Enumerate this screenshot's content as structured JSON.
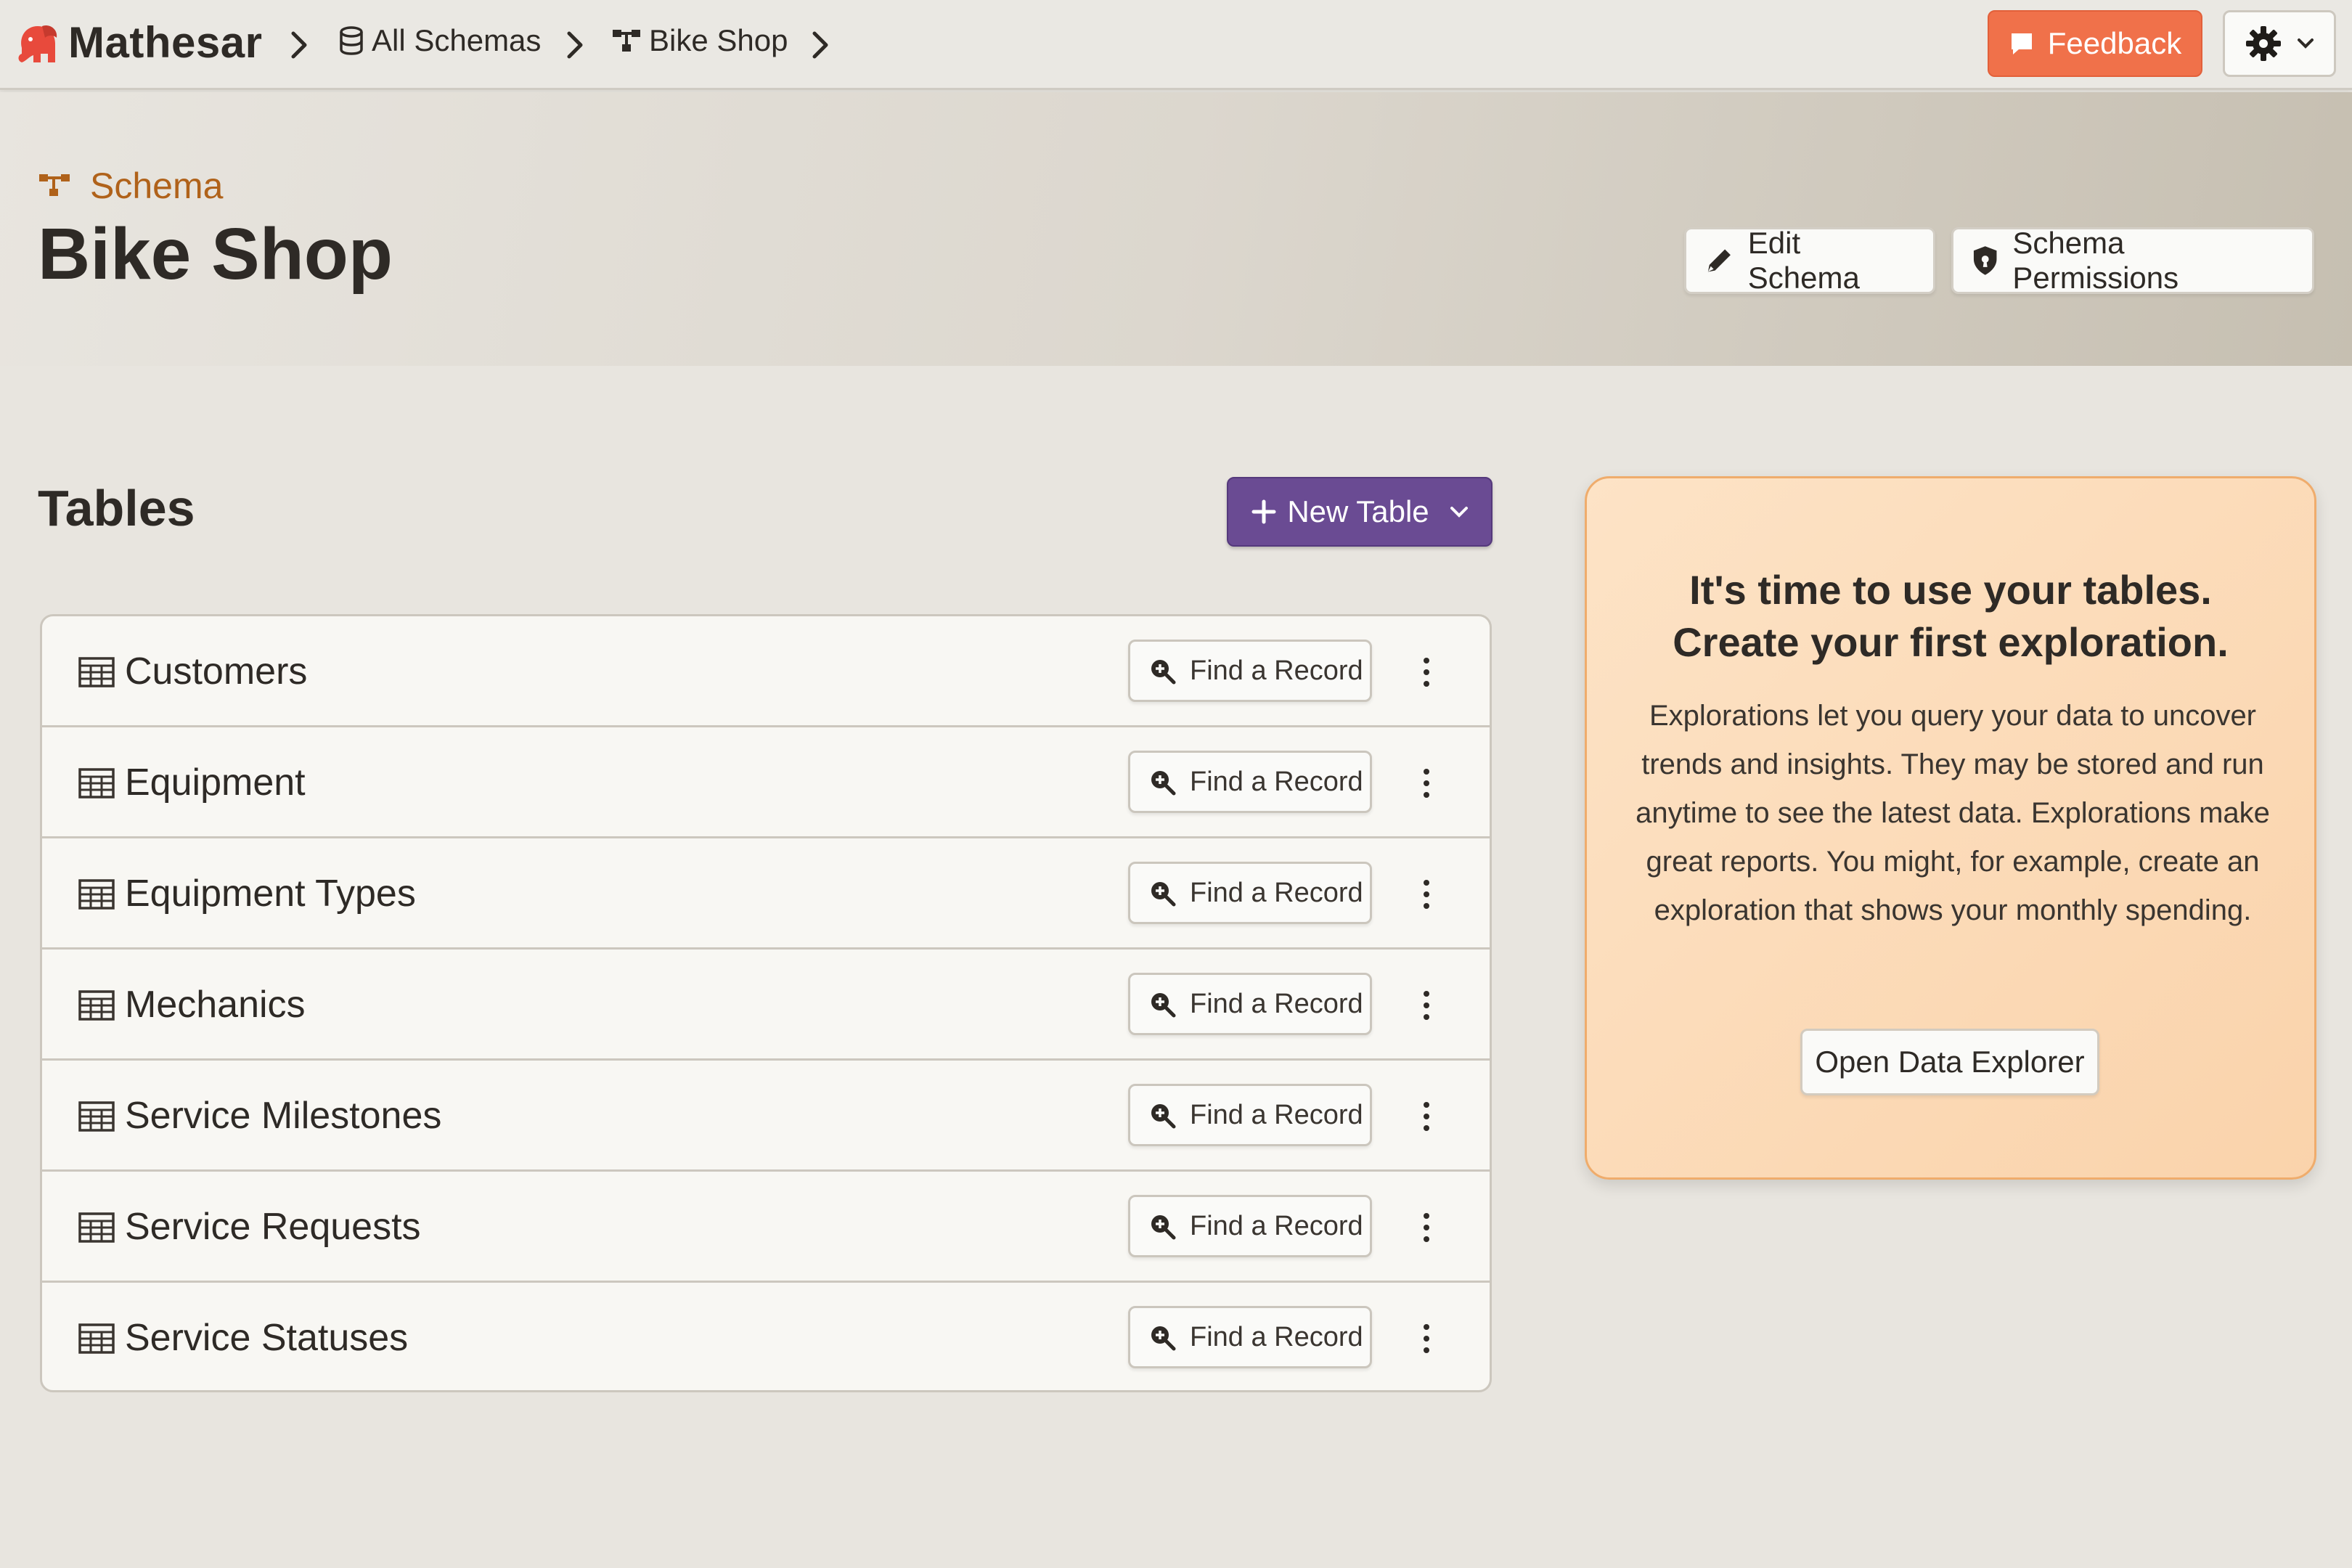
{
  "app": {
    "name": "Mathesar"
  },
  "breadcrumbs": [
    {
      "label": "All Schemas",
      "icon": "database-icon"
    },
    {
      "label": "Bike Shop",
      "icon": "schema-icon"
    }
  ],
  "topbar": {
    "feedback_label": "Feedback",
    "settings_icon": "gear-icon"
  },
  "header": {
    "kind_label": "Schema",
    "title": "Bike Shop",
    "edit_label": "Edit Schema",
    "permissions_label": "Schema Permissions"
  },
  "tables_section": {
    "title": "Tables",
    "new_table_label": "New Table",
    "find_label": "Find a Record",
    "items": [
      {
        "name": "Customers"
      },
      {
        "name": "Equipment"
      },
      {
        "name": "Equipment Types"
      },
      {
        "name": "Mechanics"
      },
      {
        "name": "Service Milestones"
      },
      {
        "name": "Service Requests"
      },
      {
        "name": "Service Statuses"
      }
    ]
  },
  "exploration_card": {
    "title_line1": "It's time to use your tables.",
    "title_line2": "Create your first exploration.",
    "body": "Explorations let you query your data to uncover trends and insights. They may be stored and run anytime to see the latest data. Explorations make great reports. You might, for example, create an exploration that shows your monthly spending.",
    "button_label": "Open Data Explorer"
  },
  "colors": {
    "accent_purple": "#6a4b93",
    "feedback_orange": "#f0714a",
    "schema_brown": "#b0621a",
    "card_bg": "#fde3c6"
  }
}
